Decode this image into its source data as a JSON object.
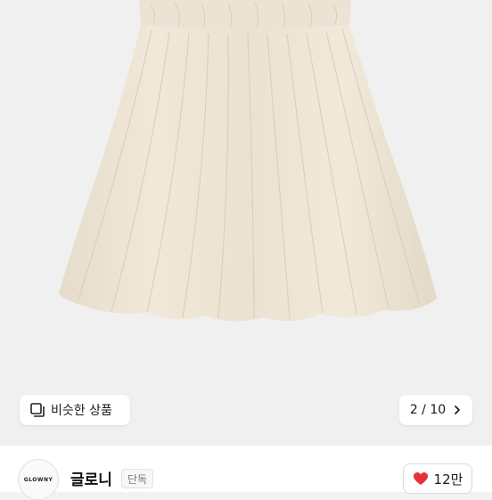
{
  "gallery": {
    "image_subject": "cream gathered midi skirt",
    "image_color": "#ede3d3",
    "similar_button": {
      "label": "비슷한 상품",
      "icon": "similar-items-icon"
    },
    "pager": {
      "current": 2,
      "total": 10,
      "text": "2 / 10",
      "icon": "chevron-right-icon"
    }
  },
  "seller": {
    "avatar_text": "GLOWNY",
    "name": "글로니",
    "tag": "단독",
    "like": {
      "count_text": "12만",
      "icon": "heart-icon",
      "color": "#e8303d"
    }
  }
}
